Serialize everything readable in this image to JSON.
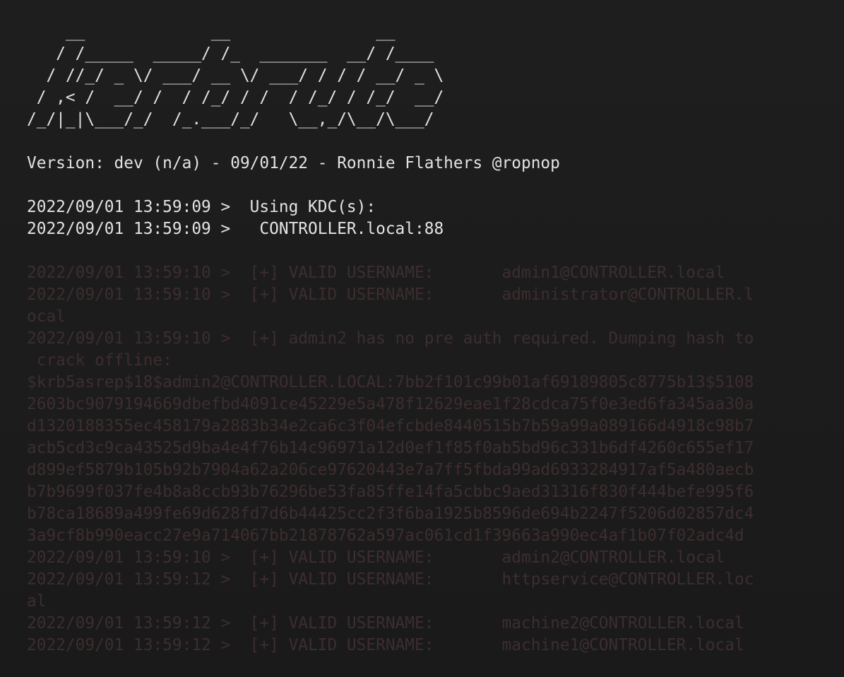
{
  "banner": {
    "lines": [
      "    __             __               __",
      "   / /_____  _____/ /_  _______  __/ /____",
      "  / //_/ _ \\/ ___/ __ \\/ ___/ / / / __/ _ \\",
      " / ,< /  __/ /  / /_/ / /  / /_/ / /_/  __/",
      "/_/|_|\\___/_/  /_.___/_/   \\__,_/\\__/\\___/"
    ]
  },
  "version_line": "Version: dev (n/a) - 09/01/22 - Ronnie Flathers @ropnop",
  "kdc": {
    "line1": "2022/09/01 13:59:09 >  Using KDC(s):",
    "line2": "2022/09/01 13:59:09 >   CONTROLLER.local:88"
  },
  "results": [
    "2022/09/01 13:59:10 >  [+] VALID USERNAME:       admin1@CONTROLLER.local",
    "2022/09/01 13:59:10 >  [+] VALID USERNAME:       administrator@CONTROLLER.l",
    "ocal",
    "2022/09/01 13:59:10 >  [+] admin2 has no pre auth required. Dumping hash to",
    " crack offline:",
    "$krb5asrep$18$admin2@CONTROLLER.LOCAL:7bb2f101c99b01af69189805c8775b13$5108",
    "2603bc9079194669dbefbd4091ce45229e5a478f12629eae1f28cdca75f0e3ed6fa345aa30a",
    "d1320188355ec458179a2883b34e2ca6c3f04efcbde8440515b7b59a99a089166d4918c98b7",
    "acb5cd3c9ca43525d9ba4e4f76b14c96971a12d0ef1f85f0ab5bd96c331b6df4260c655ef17",
    "d899ef5879b105b92b7904a62a206ce97620443e7a7ff5fbda99ad6933284917af5a480aecb",
    "b7b9699f037fe4b8a8ccb93b76296be53fa85ffe14fa5cbbc9aed31316f830f444befe995f6",
    "b78ca18689a499fe69d628fd7d6b44425cc2f3f6ba1925b8596de694b2247f5206d02857dc4",
    "3a9cf8b990eacc27e9a714067bb21878762a597ac061cd1f39663a990ec4af1b07f02adc4d",
    "2022/09/01 13:59:10 >  [+] VALID USERNAME:       admin2@CONTROLLER.local",
    "2022/09/01 13:59:12 >  [+] VALID USERNAME:       httpservice@CONTROLLER.loc",
    "al",
    "2022/09/01 13:59:12 >  [+] VALID USERNAME:       machine2@CONTROLLER.local",
    "2022/09/01 13:59:12 >  [+] VALID USERNAME:       machine1@CONTROLLER.local"
  ],
  "colors": {
    "background": "#1c1c1c",
    "foreground": "#e3e3e3",
    "dim_output": "#3d2d2f"
  }
}
